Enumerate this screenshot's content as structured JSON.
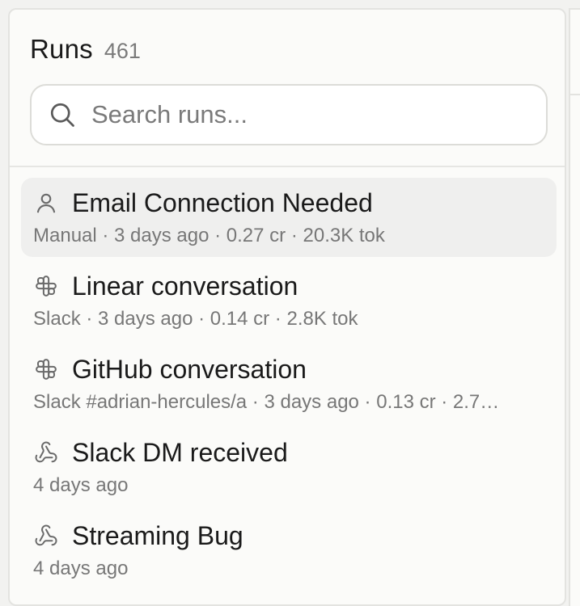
{
  "runs_panel": {
    "title": "Runs",
    "count": "461",
    "search": {
      "placeholder": "Search runs..."
    },
    "items": [
      {
        "icon": "user-icon",
        "title": "Email Connection Needed",
        "meta": "Manual · 3 days ago · 0.27 cr · 20.3K tok",
        "selected": true
      },
      {
        "icon": "slack-icon",
        "title": "Linear conversation",
        "meta": "Slack · 3 days ago · 0.14 cr · 2.8K tok",
        "selected": false
      },
      {
        "icon": "slack-icon",
        "title": "GitHub conversation",
        "meta": "Slack #adrian-hercules/a · 3 days ago · 0.13 cr · 2.7…",
        "selected": false
      },
      {
        "icon": "webhook-icon",
        "title": "Slack DM received",
        "meta": "4 days ago",
        "selected": false
      },
      {
        "icon": "webhook-icon",
        "title": "Streaming Bug",
        "meta": "4 days ago",
        "selected": false
      }
    ]
  },
  "colors": {
    "panel_bg": "#fbfbf9",
    "selected_row_bg": "#efefee",
    "primary_text": "#1a1a1a",
    "secondary_text": "#777777",
    "border": "#e3e3e0"
  }
}
